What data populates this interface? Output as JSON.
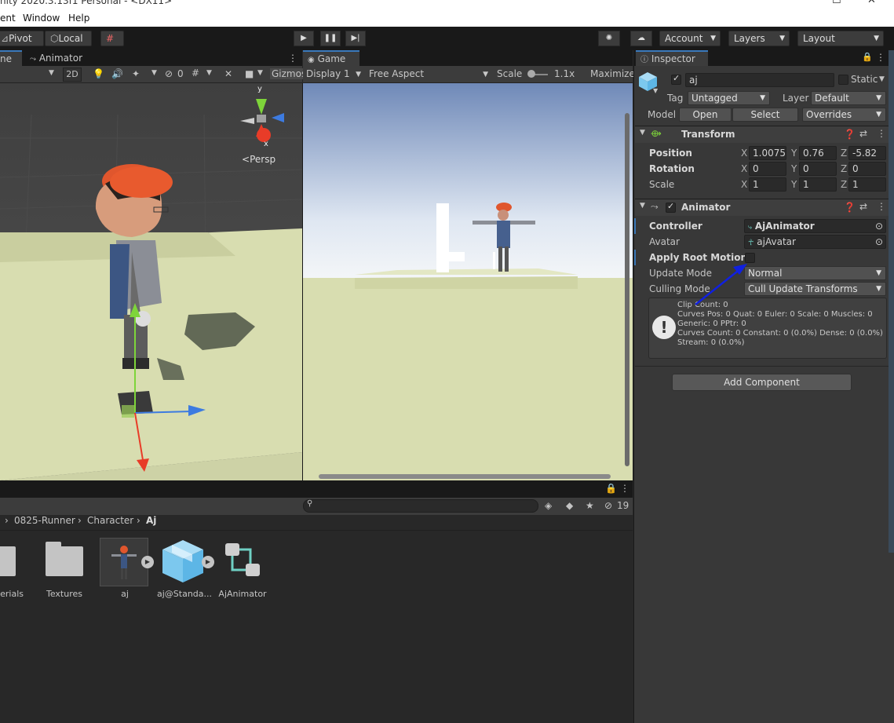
{
  "window": {
    "title": "nity 2020.3.13f1 Personal - <DX11>"
  },
  "menu": [
    "ent",
    "Window",
    "Help"
  ],
  "toolbar": {
    "pivot": "Pivot",
    "local": "Local",
    "account": "Account",
    "layers": "Layers",
    "layout": "Layout"
  },
  "scene_panel": {
    "tabs": [
      "ne",
      "Animator"
    ],
    "toggle_2d": "2D",
    "hidden_count": "0",
    "gizmos": "Gizmos",
    "persp": "Persp",
    "axes": {
      "y": "y",
      "x": "x"
    }
  },
  "game_panel": {
    "tab": "Game",
    "display": "Display 1",
    "aspect": "Free Aspect",
    "scale_label": "Scale",
    "scale_value": "1.1x",
    "maximize": "Maximize"
  },
  "project_panel": {
    "breadcrumb": [
      "0825-Runner",
      "Character",
      "Aj"
    ],
    "hidden_count": "19",
    "assets": [
      {
        "name": "terials",
        "kind": "folder"
      },
      {
        "name": "Textures",
        "kind": "folder"
      },
      {
        "name": "aj",
        "kind": "model-selected"
      },
      {
        "name": "aj@Standa...",
        "kind": "prefab"
      },
      {
        "name": "AjAnimator",
        "kind": "animator"
      }
    ]
  },
  "inspector": {
    "tab": "Inspector",
    "object_name": "aj",
    "static_label": "Static",
    "tag_label": "Tag",
    "tag_value": "Untagged",
    "layer_label": "Layer",
    "layer_value": "Default",
    "model_label": "Model",
    "open_btn": "Open",
    "select_btn": "Select",
    "overrides": "Overrides",
    "transform": {
      "title": "Transform",
      "position_label": "Position",
      "rotation_label": "Rotation",
      "scale_label": "Scale",
      "axis_x": "X",
      "axis_y": "Y",
      "axis_z": "Z",
      "position": [
        "1.00753",
        "0.76",
        "-5.82"
      ],
      "rotation": [
        "0",
        "0",
        "0"
      ],
      "scale": [
        "1",
        "1",
        "1"
      ]
    },
    "animator": {
      "title": "Animator",
      "controller_label": "Controller",
      "controller_value": "AjAnimator",
      "avatar_label": "Avatar",
      "avatar_value": "ajAvatar",
      "apply_root_motion_label": "Apply Root Motion",
      "update_mode_label": "Update Mode",
      "update_mode_value": "Normal",
      "culling_mode_label": "Culling Mode",
      "culling_mode_value": "Cull Update Transforms",
      "info": [
        "Clip Count: 0",
        "Curves Pos: 0 Quat: 0 Euler: 0 Scale: 0 Muscles: 0",
        "Generic: 0 PPtr: 0",
        "Curves Count: 0 Constant: 0 (0.0%) Dense: 0 (0.0%)",
        "Stream: 0 (0.0%)"
      ]
    },
    "add_component": "Add Component"
  },
  "colors": {
    "accent": "#3a79bb",
    "annotation_arrow": "#1020e0",
    "ground": "#d8ddb0",
    "sky_top": "#6f89b8"
  }
}
